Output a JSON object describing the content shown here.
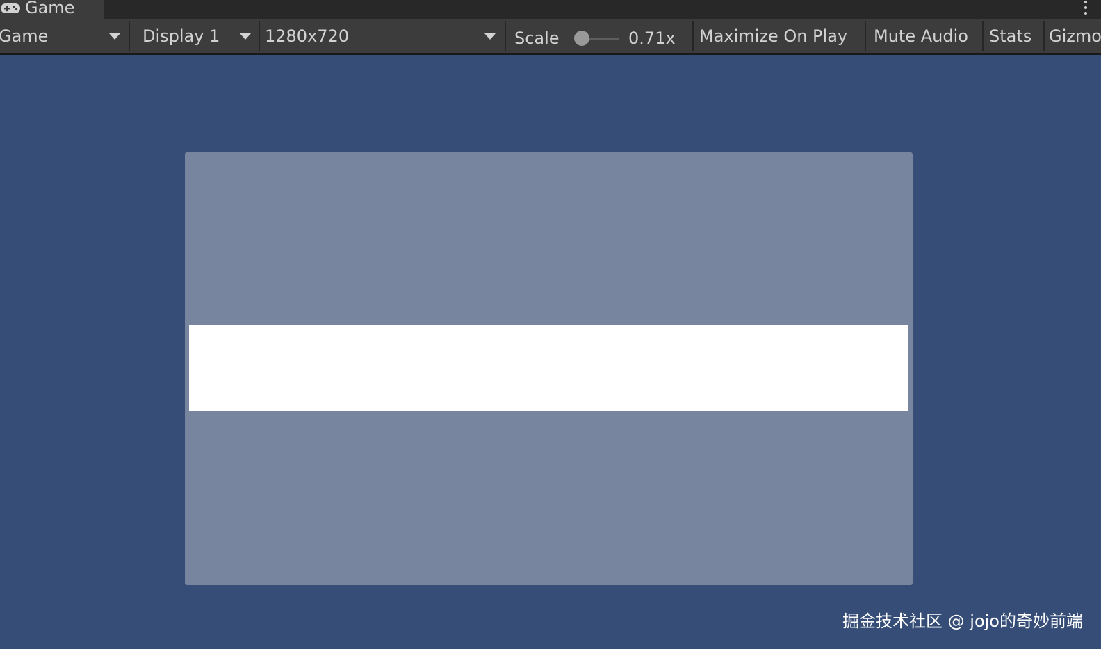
{
  "tab": {
    "icon": "gamepad-icon",
    "title": "Game"
  },
  "toolbar": {
    "view_mode": "Game",
    "display": "Display 1",
    "resolution": "1280x720",
    "scale_label": "Scale",
    "scale_value": "0.71x",
    "maximize_on_play": "Maximize On Play",
    "mute_audio": "Mute Audio",
    "stats": "Stats",
    "gizmos": "Gizmos"
  },
  "colors": {
    "viewport_background": "#354d77",
    "game_view": "#78859f",
    "white_bar": "#ffffff",
    "toolbar": "#3c3c3c",
    "tabbar": "#282828"
  },
  "watermark": "掘金技术社区 @ jojo的奇妙前端"
}
